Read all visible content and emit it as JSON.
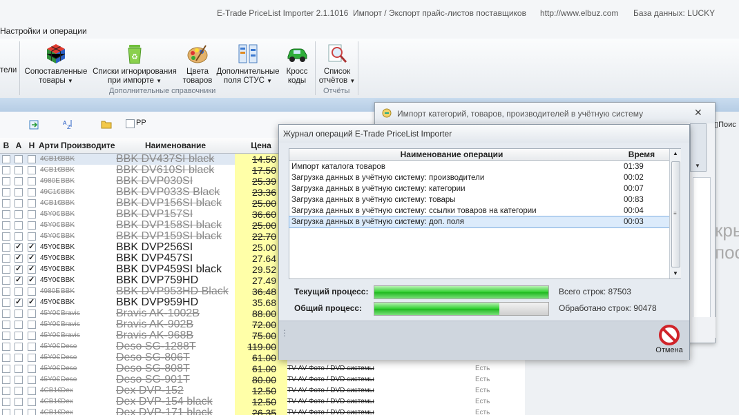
{
  "titlebar": {
    "app": "E-Trade PriceList Importer 2.1.1016",
    "subtitle": "Импорт / Экспорт прайс-листов поставщиков",
    "url": "http://www.elbuz.com",
    "database": "База данных: LUCKY"
  },
  "menu": {
    "label": "Настройки и операции"
  },
  "ribbon": {
    "cut_label": "тели",
    "buttons": [
      {
        "l1": "Сопоставленные",
        "l2": "товары",
        "icon": "rubiks-cube-icon"
      },
      {
        "l1": "Списки игнорирования",
        "l2": "при импорте",
        "icon": "recycle-bin-icon"
      },
      {
        "l1": "Цвета",
        "l2": "товаров",
        "icon": "palette-icon"
      },
      {
        "l1": "Дополнительные",
        "l2": "поля СТУС",
        "icon": "columns-icon"
      },
      {
        "l1": "Кросс",
        "l2": "коды",
        "icon": "green-car-icon"
      },
      {
        "l1": "Список",
        "l2": "отчётов",
        "icon": "magnifier-report-icon"
      }
    ],
    "groups": {
      "dictionaries": "Дополнительные справочники",
      "reports": "Отчёты"
    }
  },
  "toolbar": {
    "rp_label": "РР"
  },
  "grid": {
    "headers": {
      "b": "В",
      "a": "А",
      "n": "Н",
      "art": "Арти",
      "maker": "Производите",
      "name": "Наименование",
      "price": "Цена"
    },
    "rows": [
      {
        "a": false,
        "n": false,
        "art": "4CB1€",
        "maker": "BBK",
        "name": "BBK DV437SI black",
        "price": "14.50",
        "cat": "",
        "st": "",
        "style": "gray strike"
      },
      {
        "a": false,
        "n": false,
        "art": "4CB1€",
        "maker": "BBK",
        "name": "BBK DV610SI black",
        "price": "17.50",
        "cat": "",
        "st": "",
        "style": "gray strike"
      },
      {
        "a": false,
        "n": false,
        "art": "4980E",
        "maker": "BBK",
        "name": "BBK DVP030SI",
        "price": "25.39",
        "cat": "",
        "st": "",
        "style": "gray strike"
      },
      {
        "a": false,
        "n": false,
        "art": "49C1€",
        "maker": "BBK",
        "name": "BBK DVP033S Black",
        "price": "23.36",
        "cat": "",
        "st": "",
        "style": "gray strike"
      },
      {
        "a": false,
        "n": false,
        "art": "4CB1€",
        "maker": "BBK",
        "name": "BBK DVP156SI black",
        "price": "25.00",
        "cat": "",
        "st": "",
        "style": "gray strike"
      },
      {
        "a": false,
        "n": false,
        "art": "45Y0€",
        "maker": "BBK",
        "name": "BBK DVP157SI",
        "price": "36.60",
        "cat": "",
        "st": "",
        "style": "gray strike"
      },
      {
        "a": false,
        "n": false,
        "art": "45Y0€",
        "maker": "BBK",
        "name": "BBK DVP158SI black",
        "price": "25.00",
        "cat": "",
        "st": "",
        "style": "gray strike"
      },
      {
        "a": false,
        "n": false,
        "art": "45Y0€",
        "maker": "BBK",
        "name": "BBK DVP159SI black",
        "price": "22.70",
        "cat": "",
        "st": "",
        "style": "gray strike"
      },
      {
        "a": true,
        "n": true,
        "art": "45Y0€",
        "maker": "BBK",
        "name": "BBK DVP256SI",
        "price": "25.00",
        "cat": "",
        "st": "",
        "style": ""
      },
      {
        "a": true,
        "n": true,
        "art": "45Y0€",
        "maker": "BBK",
        "name": "BBK DVP457SI",
        "price": "27.64",
        "cat": "",
        "st": "",
        "style": ""
      },
      {
        "a": true,
        "n": true,
        "art": "45Y0€",
        "maker": "BBK",
        "name": "BBK DVP459SI black",
        "price": "29.52",
        "cat": "",
        "st": "",
        "style": ""
      },
      {
        "a": true,
        "n": true,
        "art": "45Y0€",
        "maker": "BBK",
        "name": "BBK DVP759HD",
        "price": "27.49",
        "cat": "",
        "st": "",
        "style": ""
      },
      {
        "a": false,
        "n": false,
        "art": "4980E",
        "maker": "BBK",
        "name": "BBK DVP953HD Black",
        "price": "36.48",
        "cat": "",
        "st": "",
        "style": "gray strike"
      },
      {
        "a": true,
        "n": true,
        "art": "45Y0€",
        "maker": "BBK",
        "name": "BBK DVP959HD",
        "price": "35.68",
        "cat": "",
        "st": "",
        "style": ""
      },
      {
        "a": false,
        "n": false,
        "art": "45Y0€",
        "maker": "Bravis",
        "name": "Bravis AK-1002B",
        "price": "88.00",
        "cat": "",
        "st": "",
        "style": "gray strike"
      },
      {
        "a": false,
        "n": false,
        "art": "45Y0€",
        "maker": "Bravis",
        "name": "Bravis AK-902B",
        "price": "72.00",
        "cat": "",
        "st": "",
        "style": "gray strike"
      },
      {
        "a": false,
        "n": false,
        "art": "45Y0€",
        "maker": "Bravis",
        "name": "Bravis AK-968B",
        "price": "75.00",
        "cat": "",
        "st": "",
        "style": "gray strike"
      },
      {
        "a": false,
        "n": false,
        "art": "45Y0€",
        "maker": "Deso",
        "name": "Deso SG-1288T",
        "price": "119.00",
        "cat": "",
        "st": "",
        "style": "gray strike"
      },
      {
        "a": false,
        "n": false,
        "art": "45Y0€",
        "maker": "Deso",
        "name": "Deso SG-806T",
        "price": "61.00",
        "cat": "TV-AV Фото / DVD системы",
        "st": "Есть",
        "style": "gray strike"
      },
      {
        "a": false,
        "n": false,
        "art": "45Y0€",
        "maker": "Deso",
        "name": "Deso SG-808T",
        "price": "61.00",
        "cat": "TV-AV Фото / DVD системы",
        "st": "Есть",
        "style": "gray strike"
      },
      {
        "a": false,
        "n": false,
        "art": "45Y0€",
        "maker": "Deso",
        "name": "Deso SG-901T",
        "price": "80.00",
        "cat": "TV-AV Фото / DVD системы",
        "st": "Есть",
        "style": "gray strike"
      },
      {
        "a": false,
        "n": false,
        "art": "4CB1€",
        "maker": "Dex",
        "name": "Dex DVP-152",
        "price": "12.50",
        "cat": "TV-AV Фото / DVD системы",
        "st": "Есть",
        "style": "gray strike"
      },
      {
        "a": false,
        "n": false,
        "art": "4CB1€",
        "maker": "Dex",
        "name": "Dex DVP-154 black",
        "price": "12.50",
        "cat": "TV-AV Фото / DVD системы",
        "st": "Есть",
        "style": "gray strike"
      },
      {
        "a": false,
        "n": false,
        "art": "4CB1€",
        "maker": "Dex",
        "name": "Dex DVP-171 black",
        "price": "26.35",
        "cat": "TV-AV Фото / DVD системы",
        "st": "Есть",
        "style": "gray strike"
      }
    ]
  },
  "bg_dialog": {
    "title": "Импорт категорий, товаров, производителей в учётную систему",
    "side_text_1": "кры",
    "side_text_2": "пос",
    "side_label": "Поис"
  },
  "log_dialog": {
    "title": "Журнал операций E-Trade PriceList Importer",
    "col_name": "Наименование операции",
    "col_time": "Время",
    "operations": [
      {
        "name": "Импорт каталога товаров",
        "time": "01:39"
      },
      {
        "name": "Загрузка данных в учётную систему: производители",
        "time": "00:02"
      },
      {
        "name": "Загрузка данных в учётную систему: категории",
        "time": "00:07"
      },
      {
        "name": "Загрузка данных в учётную систему: товары",
        "time": "00:83"
      },
      {
        "name": "Загрузка данных в учётную систему: ссылки товаров на категории",
        "time": "00:04"
      },
      {
        "name": "Загрузка данных в учётную систему: доп. поля",
        "time": "00:03"
      }
    ],
    "selected_index": 5,
    "current_label": "Текущий процесс:",
    "overall_label": "Общий процесс:",
    "current_progress": 1.0,
    "overall_progress": 0.72,
    "total_rows": "Всего строк: 87503",
    "processed_rows": "Обработано строк: 90478",
    "cancel_label": "Отмена"
  }
}
